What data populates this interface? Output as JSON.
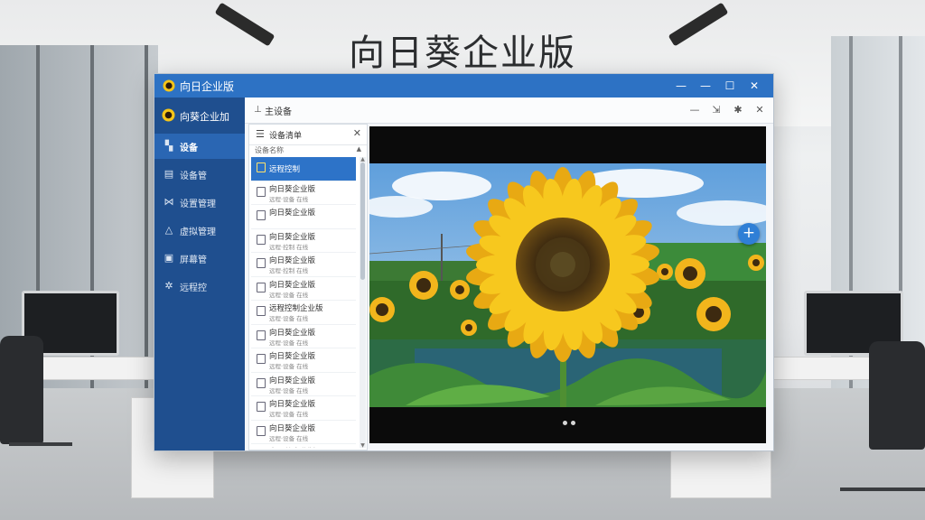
{
  "headline": "向日葵企业版",
  "window": {
    "title": "向日企业版",
    "controls": {
      "minimize": "—",
      "restore": "—",
      "maximize": "☐",
      "close": "✕"
    }
  },
  "sidebar": {
    "brand": "向葵企业加",
    "items": [
      {
        "label": "设备",
        "icon": "grid-icon",
        "glyph": "▚",
        "active": true
      },
      {
        "label": "设备管",
        "icon": "monitor-icon",
        "glyph": "▤",
        "active": false
      },
      {
        "label": "设置管理",
        "icon": "connect-icon",
        "glyph": "⋈",
        "active": false
      },
      {
        "label": "虚拟管理",
        "icon": "bell-icon",
        "glyph": "△",
        "active": false
      },
      {
        "label": "屏幕管",
        "icon": "screen-icon",
        "glyph": "▣",
        "active": false
      },
      {
        "label": "远程控",
        "icon": "gear-icon",
        "glyph": "✲",
        "active": false
      }
    ]
  },
  "subbar": {
    "title": "主设备",
    "controls": {
      "minimize": "—",
      "dock": "⇲",
      "settings": "✱",
      "close": "✕"
    }
  },
  "panel": {
    "title": "设备清单",
    "sub_label": "设备名称",
    "items": [
      {
        "title": "远程控制",
        "subtitle": "",
        "selected": true
      },
      {
        "title": "向日葵企业版",
        "subtitle": "远程·设备 在线",
        "selected": false
      },
      {
        "title": "向日葵企业版",
        "subtitle": "",
        "selected": false
      },
      {
        "title": "向日葵企业版",
        "subtitle": "远程·控制 在线",
        "selected": false
      },
      {
        "title": "向日葵企业版",
        "subtitle": "远程·控制 在线",
        "selected": false
      },
      {
        "title": "向日葵企业版",
        "subtitle": "远程·设备 在线",
        "selected": false
      },
      {
        "title": "远程控制企业版",
        "subtitle": "远程·设备 在线",
        "selected": false
      },
      {
        "title": "向日葵企业版",
        "subtitle": "远程·设备 在线",
        "selected": false
      },
      {
        "title": "向日葵企业版",
        "subtitle": "远程·设备 在线",
        "selected": false
      },
      {
        "title": "向日葵企业版",
        "subtitle": "远程·设备 在线",
        "selected": false
      },
      {
        "title": "向日葵企业版",
        "subtitle": "远程·设备 在线",
        "selected": false
      },
      {
        "title": "向日葵企业版",
        "subtitle": "远程·设备 在线",
        "selected": false
      },
      {
        "title": "向日葵企业版",
        "subtitle": "",
        "selected": false
      }
    ]
  },
  "viewer": {
    "add_label": "+",
    "slide_count": 2
  },
  "colors": {
    "accent": "#2d72c4",
    "sidebar": "#1f4f8f",
    "sidebar_active": "#2a66b3",
    "selected_row": "#2d73c8"
  }
}
